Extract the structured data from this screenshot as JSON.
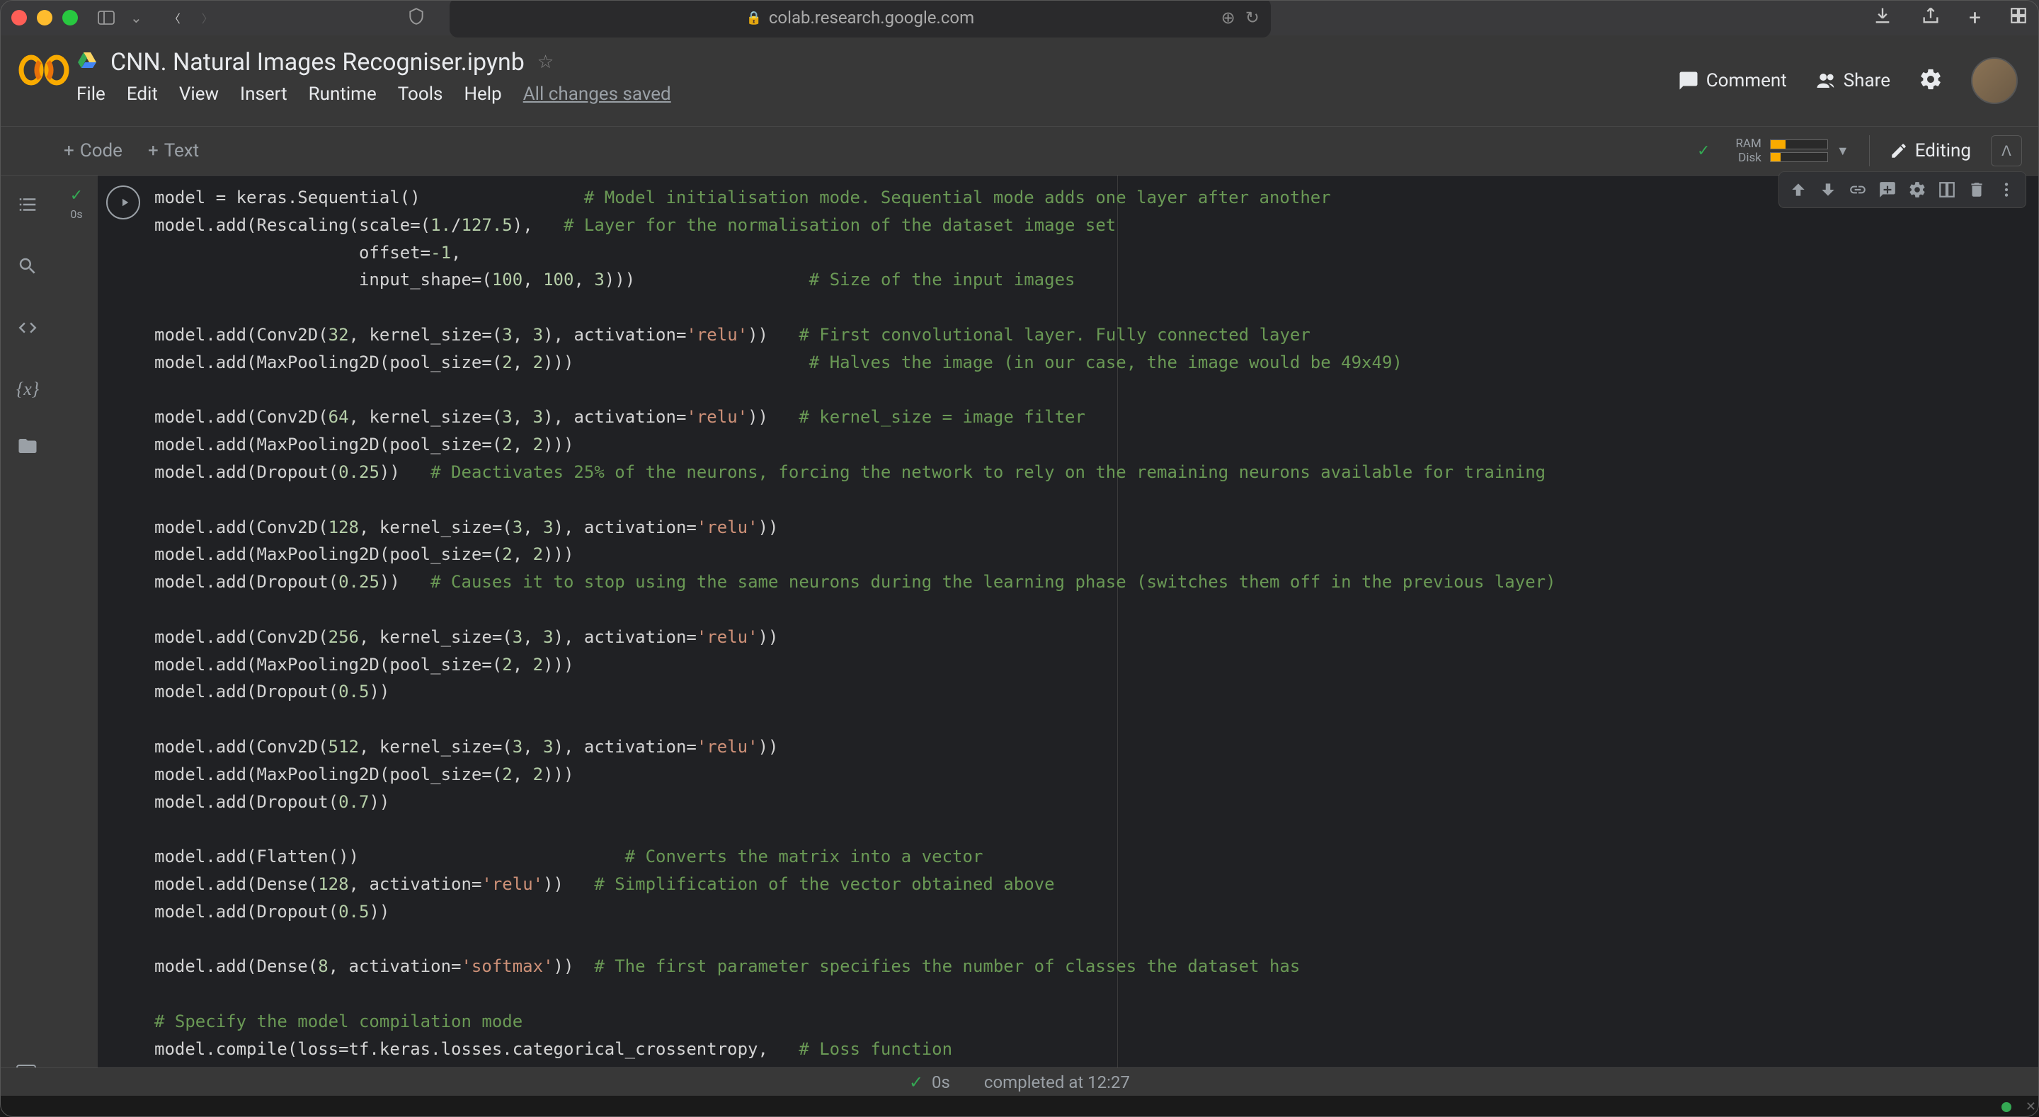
{
  "browser": {
    "url": "colab.research.google.com"
  },
  "notebook": {
    "title": "CNN. Natural Images Recogniser.ipynb",
    "autosave": "All changes saved"
  },
  "menu": {
    "file": "File",
    "edit": "Edit",
    "view": "View",
    "insert": "Insert",
    "runtime": "Runtime",
    "tools": "Tools",
    "help": "Help"
  },
  "header": {
    "comment": "Comment",
    "share": "Share",
    "editing": "Editing"
  },
  "toolbar": {
    "code": "Code",
    "text": "Text",
    "ram": "RAM",
    "disk": "Disk"
  },
  "resources": {
    "ram_pct": 26,
    "disk_pct": 18
  },
  "cell": {
    "status_time": "0s"
  },
  "status": {
    "duration": "0s",
    "completed": "completed at 12:27"
  },
  "code_tokens": [
    [
      [
        "model = keras.Sequential()",
        "p"
      ],
      [
        "                ",
        "p"
      ],
      [
        "# Model initialisation mode. Sequential mode adds one layer after another",
        "c"
      ]
    ],
    [
      [
        "model.add(Rescaling(scale=(",
        "p"
      ],
      [
        "1.",
        "n"
      ],
      [
        "/",
        "p"
      ],
      [
        "127.5",
        "n"
      ],
      [
        "),   ",
        "p"
      ],
      [
        "# Layer for the normalisation of the dataset image set",
        "c"
      ]
    ],
    [
      [
        "                    offset=",
        "p"
      ],
      [
        "-1",
        "n"
      ],
      [
        ",",
        "p"
      ]
    ],
    [
      [
        "                    input_shape=(",
        "p"
      ],
      [
        "100",
        "n"
      ],
      [
        ",",
        "p"
      ],
      [
        " 100",
        "n"
      ],
      [
        ",",
        "p"
      ],
      [
        " 3",
        "n"
      ],
      [
        ")))",
        "p"
      ],
      [
        "                 ",
        "p"
      ],
      [
        "# Size of the input images",
        "c"
      ]
    ],
    [],
    [
      [
        "model.add(Conv2D(",
        "p"
      ],
      [
        "32",
        "n"
      ],
      [
        ", kernel_size=(",
        "p"
      ],
      [
        "3",
        "n"
      ],
      [
        ",",
        "p"
      ],
      [
        " 3",
        "n"
      ],
      [
        "), activation=",
        "p"
      ],
      [
        "'relu'",
        "s"
      ],
      [
        "))   ",
        "p"
      ],
      [
        "# First convolutional layer. Fully connected layer",
        "c"
      ]
    ],
    [
      [
        "model.add(MaxPooling2D(pool_size=(",
        "p"
      ],
      [
        "2",
        "n"
      ],
      [
        ",",
        "p"
      ],
      [
        " 2",
        "n"
      ],
      [
        ")))",
        "p"
      ],
      [
        "                       ",
        "p"
      ],
      [
        "# Halves the image (in our case, the image would be 49x49)",
        "c"
      ]
    ],
    [],
    [
      [
        "model.add(Conv2D(",
        "p"
      ],
      [
        "64",
        "n"
      ],
      [
        ", kernel_size=(",
        "p"
      ],
      [
        "3",
        "n"
      ],
      [
        ",",
        "p"
      ],
      [
        " 3",
        "n"
      ],
      [
        "), activation=",
        "p"
      ],
      [
        "'relu'",
        "s"
      ],
      [
        "))   ",
        "p"
      ],
      [
        "# kernel_size = image filter",
        "c"
      ]
    ],
    [
      [
        "model.add(MaxPooling2D(pool_size=(",
        "p"
      ],
      [
        "2",
        "n"
      ],
      [
        ",",
        "p"
      ],
      [
        " 2",
        "n"
      ],
      [
        ")))",
        "p"
      ]
    ],
    [
      [
        "model.add(Dropout(",
        "p"
      ],
      [
        "0.25",
        "n"
      ],
      [
        "))   ",
        "p"
      ],
      [
        "# Deactivates 25% of the neurons, forcing the network to rely on the remaining neurons available for training",
        "c"
      ]
    ],
    [],
    [
      [
        "model.add(Conv2D(",
        "p"
      ],
      [
        "128",
        "n"
      ],
      [
        ", kernel_size=(",
        "p"
      ],
      [
        "3",
        "n"
      ],
      [
        ",",
        "p"
      ],
      [
        " 3",
        "n"
      ],
      [
        "), activation=",
        "p"
      ],
      [
        "'relu'",
        "s"
      ],
      [
        "))",
        "p"
      ]
    ],
    [
      [
        "model.add(MaxPooling2D(pool_size=(",
        "p"
      ],
      [
        "2",
        "n"
      ],
      [
        ",",
        "p"
      ],
      [
        " 2",
        "n"
      ],
      [
        ")))",
        "p"
      ]
    ],
    [
      [
        "model.add(Dropout(",
        "p"
      ],
      [
        "0.25",
        "n"
      ],
      [
        "))   ",
        "p"
      ],
      [
        "# Causes it to stop using the same neurons during the learning phase (switches them off in the previous layer)",
        "c"
      ]
    ],
    [],
    [
      [
        "model.add(Conv2D(",
        "p"
      ],
      [
        "256",
        "n"
      ],
      [
        ", kernel_size=(",
        "p"
      ],
      [
        "3",
        "n"
      ],
      [
        ",",
        "p"
      ],
      [
        " 3",
        "n"
      ],
      [
        "), activation=",
        "p"
      ],
      [
        "'relu'",
        "s"
      ],
      [
        "))",
        "p"
      ]
    ],
    [
      [
        "model.add(MaxPooling2D(pool_size=(",
        "p"
      ],
      [
        "2",
        "n"
      ],
      [
        ",",
        "p"
      ],
      [
        " 2",
        "n"
      ],
      [
        ")))",
        "p"
      ]
    ],
    [
      [
        "model.add(Dropout(",
        "p"
      ],
      [
        "0.5",
        "n"
      ],
      [
        "))",
        "p"
      ]
    ],
    [],
    [
      [
        "model.add(Conv2D(",
        "p"
      ],
      [
        "512",
        "n"
      ],
      [
        ", kernel_size=(",
        "p"
      ],
      [
        "3",
        "n"
      ],
      [
        ",",
        "p"
      ],
      [
        " 3",
        "n"
      ],
      [
        "), activation=",
        "p"
      ],
      [
        "'relu'",
        "s"
      ],
      [
        "))",
        "p"
      ]
    ],
    [
      [
        "model.add(MaxPooling2D(pool_size=(",
        "p"
      ],
      [
        "2",
        "n"
      ],
      [
        ",",
        "p"
      ],
      [
        " 2",
        "n"
      ],
      [
        ")))",
        "p"
      ]
    ],
    [
      [
        "model.add(Dropout(",
        "p"
      ],
      [
        "0.7",
        "n"
      ],
      [
        "))",
        "p"
      ]
    ],
    [],
    [
      [
        "model.add(Flatten())",
        "p"
      ],
      [
        "                          ",
        "p"
      ],
      [
        "# Converts the matrix into a vector",
        "c"
      ]
    ],
    [
      [
        "model.add(Dense(",
        "p"
      ],
      [
        "128",
        "n"
      ],
      [
        ", activation=",
        "p"
      ],
      [
        "'relu'",
        "s"
      ],
      [
        "))   ",
        "p"
      ],
      [
        "# Simplification of the vector obtained above",
        "c"
      ]
    ],
    [
      [
        "model.add(Dropout(",
        "p"
      ],
      [
        "0.5",
        "n"
      ],
      [
        "))",
        "p"
      ]
    ],
    [],
    [
      [
        "model.add(Dense(",
        "p"
      ],
      [
        "8",
        "n"
      ],
      [
        ", activation=",
        "p"
      ],
      [
        "'softmax'",
        "s"
      ],
      [
        "))  ",
        "p"
      ],
      [
        "# The first parameter specifies the number of classes the dataset has",
        "c"
      ]
    ],
    [],
    [
      [
        "# Specify the model compilation mode",
        "c"
      ]
    ],
    [
      [
        "model.compile(loss=tf.keras.losses.categorical_crossentropy,   ",
        "p"
      ],
      [
        "# Loss function",
        "c"
      ]
    ]
  ]
}
